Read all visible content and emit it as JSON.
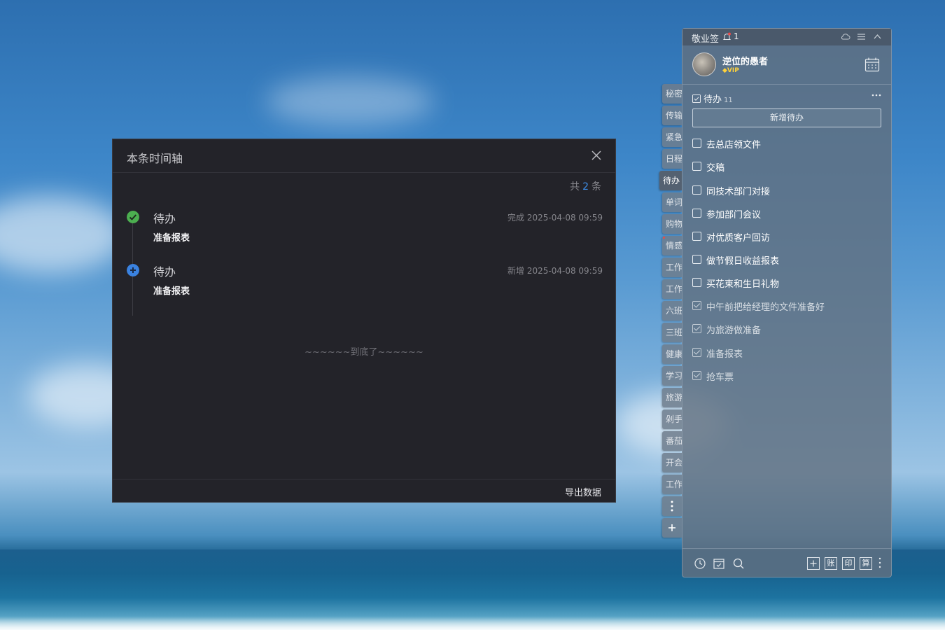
{
  "dialog": {
    "title": "本条时间轴",
    "count_prefix": "共",
    "count_value": "2",
    "count_suffix": "条",
    "entries": [
      {
        "title": "待办",
        "time": "完成 2025-04-08 09:59",
        "content": "准备报表",
        "status": "done"
      },
      {
        "title": "待办",
        "time": "新增 2025-04-08 09:59",
        "content": "准备报表",
        "status": "added"
      }
    ],
    "end_text": "~~~~~~到底了~~~~~~",
    "export_label": "导出数据"
  },
  "side_tabs": [
    "秘密",
    "传输",
    "紧急",
    "日程",
    "待办",
    "单词",
    "购物",
    "情感",
    "工作",
    "工作",
    "六班",
    "三班",
    "健康",
    "学习",
    "旅游",
    "剁手",
    "番茄",
    "开会",
    "工作"
  ],
  "panel": {
    "app_name": "敬业签",
    "notification_count": "1",
    "username": "逆位的愚者",
    "vip_label": "VIP",
    "section_title": "待办",
    "section_count": "11",
    "add_todo_label": "新增待办",
    "todos": [
      {
        "text": "去总店领文件",
        "done": false
      },
      {
        "text": "交稿",
        "done": false
      },
      {
        "text": "同技术部门对接",
        "done": false
      },
      {
        "text": "参加部门会议",
        "done": false
      },
      {
        "text": "对优质客户回访",
        "done": false
      },
      {
        "text": "做节假日收益报表",
        "done": false
      },
      {
        "text": "买花束和生日礼物",
        "done": false
      },
      {
        "text": "中午前把给经理的文件准备好",
        "done": true
      },
      {
        "text": "为旅游做准备",
        "done": true
      },
      {
        "text": "准备报表",
        "done": true
      },
      {
        "text": "抢车票",
        "done": true
      }
    ],
    "bottom_buttons": [
      "账",
      "印",
      "算"
    ]
  },
  "colors": {
    "accent_blue": "#3e8ee8",
    "done_green": "#4caf50",
    "added_blue": "#3a82e0"
  }
}
